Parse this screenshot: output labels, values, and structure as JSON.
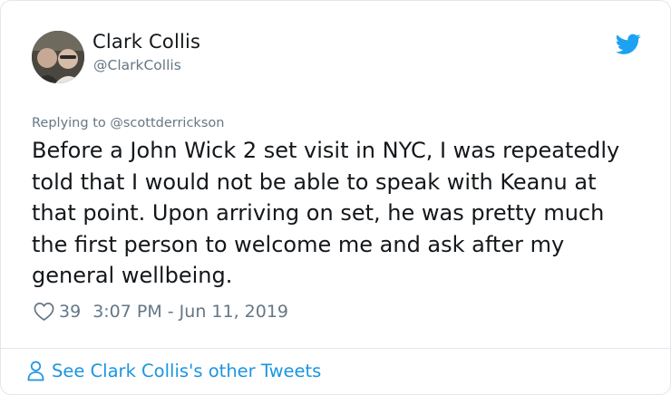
{
  "tweet": {
    "author_name": "Clark Collis",
    "author_handle": "@ClarkCollis",
    "reply_prefix": "Replying to ",
    "reply_to": "@scottderrickson",
    "text": "Before a John Wick 2 set visit in NYC, I was repeatedly told that I would not be able to speak with Keanu at that point. Upon arriving on set, he was pretty much the first person to welcome me and ask after my general wellbeing.",
    "likes": "39",
    "timestamp": "3:07 PM - Jun 11, 2019"
  },
  "footer": {
    "link_label": "See Clark Collis's other Tweets"
  },
  "icons": {
    "brand": "twitter-bird-icon",
    "like": "heart-icon",
    "profile": "person-icon"
  },
  "colors": {
    "brand_blue": "#1da1f2",
    "link_blue": "#1b95e0",
    "secondary_text": "#657786",
    "border": "#e1e8ed"
  }
}
